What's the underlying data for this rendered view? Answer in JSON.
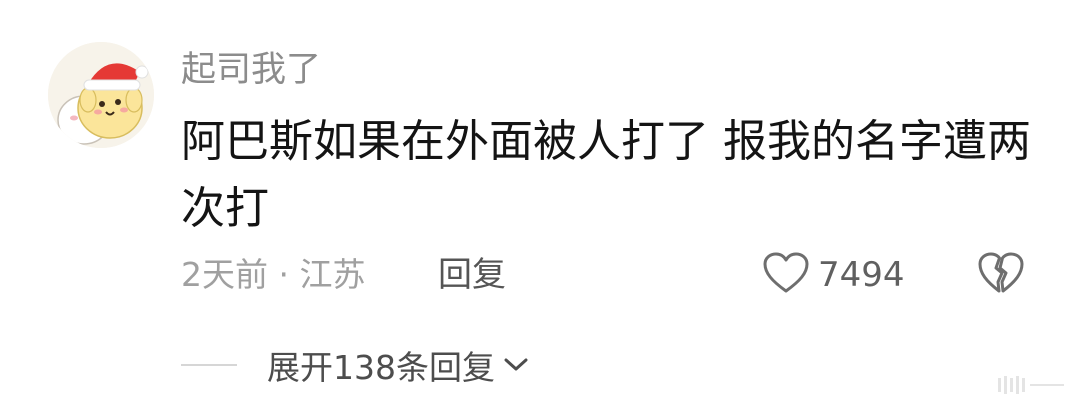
{
  "comment": {
    "username": "起司我了",
    "text": "阿巴斯如果在外面被人打了 报我的名字遭两次打",
    "time_location": "2天前 · 江苏",
    "reply_label": "回复",
    "like_count": "7494",
    "expand_replies_label": "展开138条回复"
  },
  "icons": {
    "avatar": "cartoon-avatar-with-santa-hat",
    "like": "heart-outline-icon",
    "dislike": "broken-heart-icon",
    "expand": "chevron-down-icon"
  },
  "colors": {
    "username": "#8c8c8c",
    "body_text": "#141414",
    "meta": "#a0a0a0",
    "santa_hat": "#e53935"
  }
}
